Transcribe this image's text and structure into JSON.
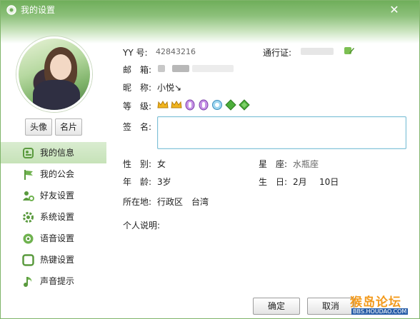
{
  "window": {
    "title": "我的设置"
  },
  "avatar_buttons": {
    "avatar": "头像",
    "card": "名片"
  },
  "nav": {
    "items": [
      {
        "label": "我的信息",
        "icon": "profile-card-icon",
        "active": true
      },
      {
        "label": "我的公会",
        "icon": "flag-icon",
        "active": false
      },
      {
        "label": "好友设置",
        "icon": "friend-gear-icon",
        "active": false
      },
      {
        "label": "系统设置",
        "icon": "gear-icon",
        "active": false
      },
      {
        "label": "语音设置",
        "icon": "speaker-icon",
        "active": false
      },
      {
        "label": "热键设置",
        "icon": "keyboard-icon",
        "active": false
      },
      {
        "label": "声音提示",
        "icon": "music-note-icon",
        "active": false
      }
    ]
  },
  "profile": {
    "yy_label": "YY 号:",
    "yy_value": "42843216",
    "pass_label": "通行证:",
    "email_label": "邮　箱:",
    "nick_label": "昵　称:",
    "nick_value": "小悦↘",
    "level_label": "等　级:",
    "sign_label": "签　名:",
    "gender_label": "性　别:",
    "gender_value": "女",
    "star_label": "星　座:",
    "star_value": "水瓶座",
    "age_label": "年　龄:",
    "age_value": "3岁",
    "birth_label": "生　日:",
    "birth_month": "2月",
    "birth_day": "10日",
    "location_label": "所在地:",
    "location_value": "行政区　台湾",
    "desc_label": "个人说明:"
  },
  "footer": {
    "ok": "确定",
    "cancel": "取消"
  },
  "watermark": {
    "title": "猴岛论坛",
    "sub": "BBS.HOUDAO.COM"
  },
  "colors": {
    "accent": "#6fae5a",
    "nav_active": "#c6e2b8",
    "sign_border": "#7fc0d6"
  }
}
